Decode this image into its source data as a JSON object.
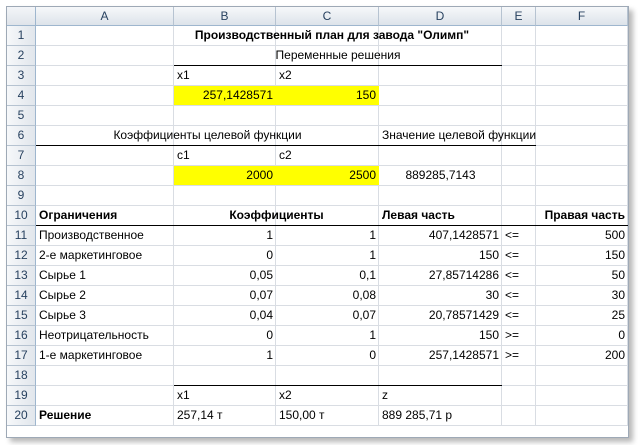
{
  "columns": [
    "A",
    "B",
    "C",
    "D",
    "E",
    "F"
  ],
  "rows": [
    "1",
    "2",
    "3",
    "4",
    "5",
    "6",
    "7",
    "8",
    "9",
    "10",
    "11",
    "12",
    "13",
    "14",
    "15",
    "16",
    "17",
    "18",
    "19",
    "20"
  ],
  "sheet": {
    "title": "Производственный план для завода \"Олимп\"",
    "var_header": "Переменные решения",
    "x1_label": "x1",
    "x2_label": "x2",
    "x1_value": "257,1428571",
    "x2_value": "150",
    "coef_header": "Коэффициенты целевой функции",
    "objective_header": "Значение целевой функции",
    "c1_label": "c1",
    "c2_label": "c2",
    "c1_value": "2000",
    "c2_value": "2500",
    "objective_value": "889285,7143",
    "constraints_header": "Ограничения",
    "coefficients_header": "Коэффициенты",
    "lhs_header": "Левая часть",
    "rhs_header": "Правая часть",
    "constraints": [
      {
        "name": "Производственное",
        "a1": "1",
        "a2": "1",
        "lhs": "407,1428571",
        "op": "<=",
        "rhs": "500"
      },
      {
        "name": "2-е маркетинговое",
        "a1": "0",
        "a2": "1",
        "lhs": "150",
        "op": "<=",
        "rhs": "150"
      },
      {
        "name": "Сырье 1",
        "a1": "0,05",
        "a2": "0,1",
        "lhs": "27,85714286",
        "op": "<=",
        "rhs": "50"
      },
      {
        "name": "Сырье 2",
        "a1": "0,07",
        "a2": "0,08",
        "lhs": "30",
        "op": "<=",
        "rhs": "30"
      },
      {
        "name": "Сырье 3",
        "a1": "0,04",
        "a2": "0,07",
        "lhs": "20,78571429",
        "op": "<=",
        "rhs": "25"
      },
      {
        "name": "Неотрицательность",
        "a1": "0",
        "a2": "1",
        "lhs": "150",
        "op": ">=",
        "rhs": "0"
      },
      {
        "name": "1-е маркетинговое",
        "a1": "1",
        "a2": "0",
        "lhs": "257,1428571",
        "op": ">=",
        "rhs": "200"
      }
    ],
    "sol_x1_label": "x1",
    "sol_x2_label": "x2",
    "sol_z_label": "z",
    "solution_label": "Решение",
    "sol_x1": "257,14 т",
    "sol_x2": "150,00 т",
    "sol_z": "889 285,71 р"
  },
  "colors": {
    "input_fill": "#ffff00",
    "header_text": "#27415f"
  }
}
